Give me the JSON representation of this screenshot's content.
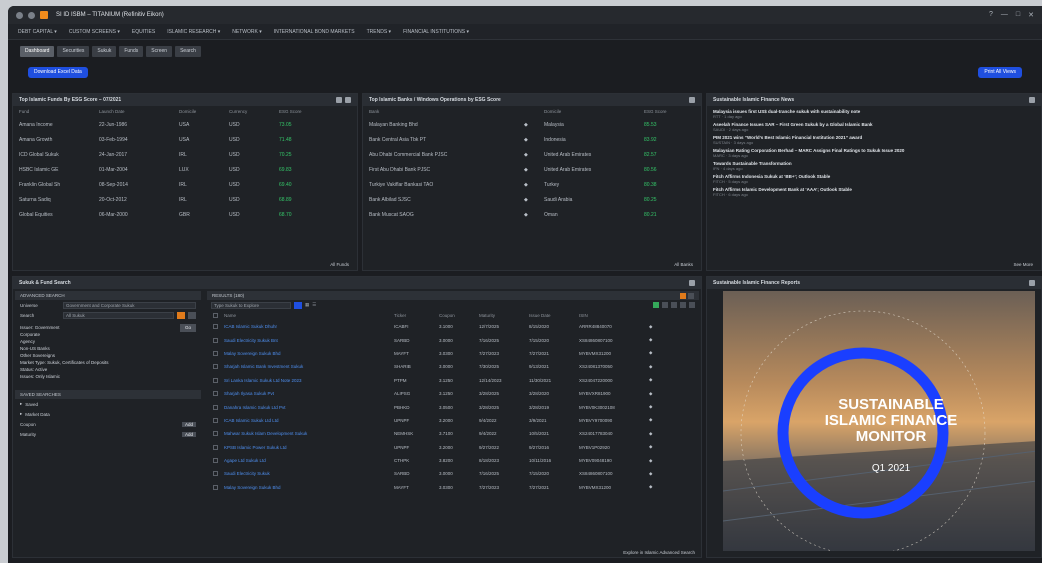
{
  "window": {
    "title": "SI ID ISBM – TITANIUM (Refinitiv Eikon)",
    "controls": [
      "?",
      "—",
      "□",
      "✕"
    ]
  },
  "menu": [
    "DEBT CAPITAL ▾",
    "CUSTOM SCREENS ▾",
    "EQUITIES",
    "ISLAMIC RESEARCH ▾",
    "NETWORK ▾",
    "INTERNATIONAL BOND MARKETS",
    "TRENDS ▾",
    "FINANCIAL INSTITUTIONS ▾"
  ],
  "tabs": [
    "Dashboard",
    "Securities",
    "Sukuk",
    "Funds",
    "Screen",
    "Search"
  ],
  "actions": {
    "left_button": "Download Excel Data",
    "right_button": "Print All Views"
  },
  "panel_esg": {
    "title": "Top Islamic Funds By ESG Score – 07/2021",
    "headers": [
      "Fund",
      "Launch Date",
      "Domicile",
      "Currency",
      "ESG Score"
    ],
    "rows": [
      [
        "Amana Income",
        "22-Jun-1986",
        "USA",
        "USD",
        "73.05"
      ],
      [
        "Amana Growth",
        "03-Feb-1994",
        "USA",
        "USD",
        "71.48"
      ],
      [
        "ICD Global Sukuk",
        "24-Jan-2017",
        "IRL",
        "USD",
        "70.25"
      ],
      [
        "HSBC Islamic GE",
        "01-Mar-2004",
        "LUX",
        "USD",
        "69.83"
      ],
      [
        "Franklin Global Sh",
        "08-Sep-2014",
        "IRL",
        "USD",
        "69.40"
      ],
      [
        "Saturna Sadiq",
        "20-Oct-2012",
        "IRL",
        "USD",
        "68.89"
      ],
      [
        "Global Equities",
        "06-Mar-2000",
        "GBR",
        "USD",
        "68.70"
      ]
    ],
    "footer": "All Funds"
  },
  "panel_banks": {
    "title": "Top Islamic Banks / Windows Operations by ESG Score",
    "headers": [
      "Bank",
      "",
      "Domicile",
      "ESG Score"
    ],
    "rows": [
      [
        "Malayan Banking Bhd",
        "Malaysia",
        "85.53"
      ],
      [
        "Bank Central Asia Tbk PT",
        "Indonesia",
        "83.92"
      ],
      [
        "Abu Dhabi Commercial Bank PJSC",
        "United Arab Emirates",
        "82.57"
      ],
      [
        "First Abu Dhabi Bank PJSC",
        "United Arab Emirates",
        "80.56"
      ],
      [
        "Turkiye Vakiflar Bankasi TAO",
        "Turkey",
        "80.38"
      ],
      [
        "Bank Albilad SJSC",
        "Saudi Arabia",
        "80.25"
      ],
      [
        "Bank Muscat SAOG",
        "Oman",
        "80.21"
      ]
    ],
    "footer": "All Banks"
  },
  "panel_news": {
    "title": "Sustainable Islamic Finance News",
    "items": [
      [
        "Malaysia issues first US$ dual-tranche sukuk with sustainability note",
        "RTT · 1 day ago"
      ],
      [
        "Aseelah Finance Issues SAR – First Green Sukuk by a Global Islamic Bank",
        "SAUDI · 2 days ago"
      ],
      [
        "PIM 2021 wins “World’s Best Islamic Financial Institution 2021” award",
        "SUSTAIN · 3 days ago"
      ],
      [
        "Malaysian Rating Corporation Berhad – MARC Assigns Final Ratings to Sukuk Issue 2020",
        "MARC · 3 days ago"
      ],
      [
        "Towards Sustainable Transformation",
        "IFN · 4 days ago"
      ],
      [
        "Fitch Affirms Indonesia Sukuk at ‘BB+’; Outlook Stable",
        "FITCH · 5 days ago"
      ],
      [
        "Fitch Affirms Islamic Development Bank at ‘AAA’; Outlook Stable",
        "FITCH · 6 days ago"
      ]
    ],
    "footer": "See More"
  },
  "panel_search": {
    "title": "Sukuk & Fund Search",
    "side_title": "ADVANCED SEARCH",
    "field1_label": "Universe",
    "field1_value": "Government and Corporate Sukuk",
    "field2_label": "Search",
    "field2_value": "All Sukuk",
    "go_label": "Go",
    "criteria": [
      "Issuer: Government",
      "Corporate",
      "Agency",
      "Non-US Banks",
      "Other Sovereigns",
      "Market Type: Sukuk, Certificates of Deposits",
      "Status: Active",
      "Issues: Only Islamic"
    ],
    "saved_title": "SAVED SEARCHES",
    "saved_items": [
      "Saved",
      "Market Data"
    ],
    "coupon_label": "Coupon",
    "coupon_btn": "Add",
    "maturity_label": "Maturity",
    "maturity_btn": "Add",
    "results_title": "RESULTS (180)",
    "search_placeholder": "Type Sukuk to Explore",
    "results_headers": [
      "Name",
      "Ticker",
      "Coupon",
      "Maturity",
      "Issue Date",
      "ISIN"
    ],
    "results": [
      [
        "ICAB Islamic Sukuk Dhuhr",
        "ICABFI",
        "3.1000",
        "12/7/2025",
        "8/15/2020",
        "ARRR48840070"
      ],
      [
        "Saudi Electricity Sukuk Bnt",
        "SARBD",
        "3.0000",
        "7/16/2025",
        "7/15/2020",
        "XS84860807100"
      ],
      [
        "Malay Sovereign Sukuk Bhd",
        "MAYFT",
        "3.0300",
        "7/27/2023",
        "7/27/2021",
        "MYBVMX31200"
      ],
      [
        "Sharjah Islamic Bank Investment Sukuk",
        "SHARIB",
        "3.0000",
        "7/30/2025",
        "9/13/2021",
        "XS24081370050"
      ],
      [
        "Sri Lanka Islamic Sukuk Ltd Note 2023",
        "PTPM",
        "3.1250",
        "12/14/2023",
        "11/30/2021",
        "XS24047220000"
      ],
      [
        "Sharjah Ilyasa Sukuk Pvt",
        "ALIPSG",
        "3.1250",
        "3/28/2025",
        "3/28/2020",
        "MYBVXR81900"
      ],
      [
        "Danahra Islamic Sukuk Ltd Pvt",
        "PBHKD",
        "3.0500",
        "3/28/2025",
        "3/28/2019",
        "MYBV0K3002108"
      ],
      [
        "ICAB Islamic Sukuk Ltd Ltd",
        "UPNPF",
        "3.2000",
        "9/4/2022",
        "3/9/2021",
        "MYBVY9700090"
      ],
      [
        "Mahwar Sukuk Islam Development Sukuk",
        "NEMHSK",
        "3.7100",
        "9/4/2022",
        "10/5/2021",
        "XS24017783040"
      ],
      [
        "KPSB Islamic Power Sukuk Ltd",
        "UPNPF",
        "3.2000",
        "9/27/2022",
        "9/27/2016",
        "MYBV1P02920"
      ],
      [
        "Agape Ltd Sukuk Ltd",
        "CTHPK",
        "3.8200",
        "8/18/2023",
        "10/11/2016",
        "MYBV09048190"
      ],
      [
        "Saudi Electricity Sukuk",
        "SARBD",
        "3.0000",
        "7/16/2025",
        "7/15/2020",
        "XS84860807100"
      ],
      [
        "Malay Sovereign Sukuk Bhd",
        "MAYFT",
        "3.0300",
        "7/27/2023",
        "7/27/2021",
        "MYBVMX31200"
      ]
    ],
    "footer": "Explore in Islamic Advanced Search"
  },
  "panel_report": {
    "title": "Sustainable Islamic Finance Reports",
    "report_title_lines": [
      "SUSTAINABLE",
      "ISLAMIC FINANCE",
      "MONITOR"
    ],
    "report_period": "Q1 2021"
  },
  "colors": {
    "accent_blue": "#1f4fe0",
    "positive_green": "#35c86a",
    "link_blue": "#4e8ff0",
    "ring_blue": "#1a3fff"
  }
}
